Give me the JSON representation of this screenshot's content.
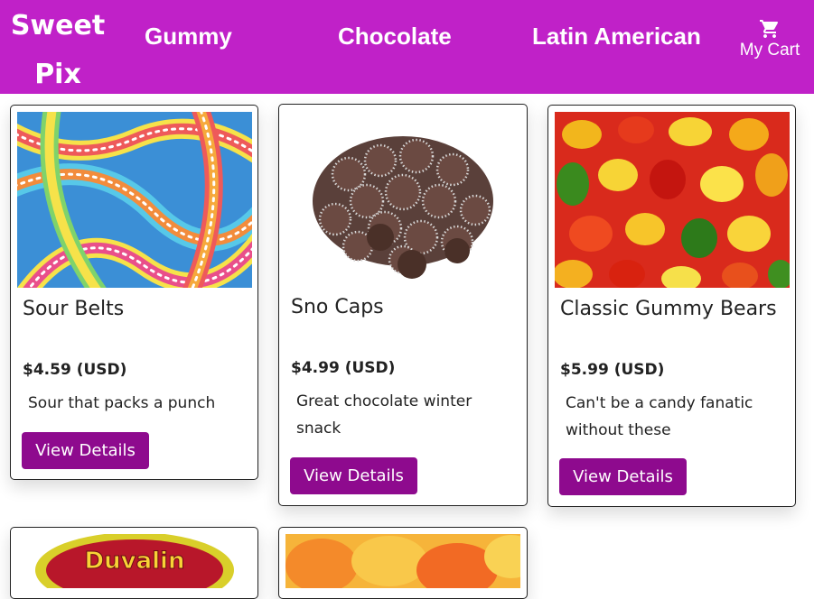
{
  "brand": {
    "line1": "Sweet",
    "line2": "Pix"
  },
  "nav": {
    "links": [
      {
        "label": "Gummy"
      },
      {
        "label": "Chocolate"
      },
      {
        "label": "Latin American"
      }
    ],
    "cart_label": "My Cart",
    "cart_icon": "shopping-cart-icon"
  },
  "products": [
    {
      "name": "Sour Belts",
      "price": "$4.59 (USD)",
      "description": "Sour that packs a punch",
      "button": "View Details",
      "image": "sour-belts-photo"
    },
    {
      "name": "Sno Caps",
      "price": "$4.99 (USD)",
      "description": "Great chocolate winter snack",
      "button": "View Details",
      "image": "sno-caps-photo"
    },
    {
      "name": "Classic Gummy Bears",
      "price": "$5.99 (USD)",
      "description": "Can't be a candy fanatic without these",
      "button": "View Details",
      "image": "gummy-bears-photo"
    }
  ],
  "partial_cards": [
    {
      "image": "duvalin-photo",
      "visible_text": "Duvalin"
    },
    {
      "image": "peach-rings-photo"
    }
  ],
  "colors": {
    "nav_bg": "#c021c8",
    "button_bg": "#8e0a8e"
  }
}
